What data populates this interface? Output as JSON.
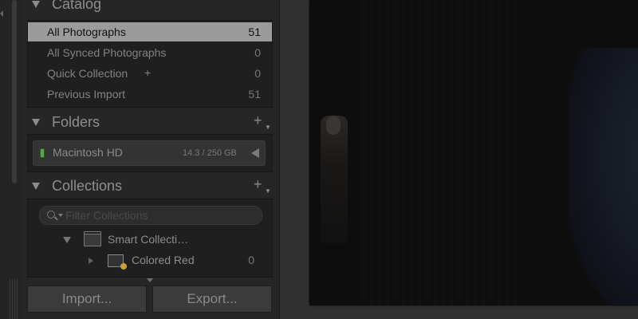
{
  "catalog": {
    "title": "Catalog",
    "items": [
      {
        "label": "All Photographs",
        "count": "51",
        "selected": true
      },
      {
        "label": "All Synced Photographs",
        "count": "0"
      },
      {
        "label": "Quick Collection",
        "plus": "+",
        "count": "0"
      },
      {
        "label": "Previous Import",
        "count": "51"
      }
    ]
  },
  "folders": {
    "title": "Folders",
    "add": "+",
    "volume": {
      "name": "Macintosh HD",
      "size": "14.3 / 250 GB"
    }
  },
  "collections": {
    "title": "Collections",
    "add": "+",
    "filter_placeholder": "Filter Collections",
    "items": [
      {
        "label": "Smart Collecti…"
      },
      {
        "label": "Colored Red",
        "count": "0"
      }
    ]
  },
  "buttons": {
    "import": "Import...",
    "export": "Export..."
  },
  "colors": {
    "volume_led": "#58a447",
    "selected_row": "#9b9b9b",
    "smart_badge": "#c9a13a"
  }
}
